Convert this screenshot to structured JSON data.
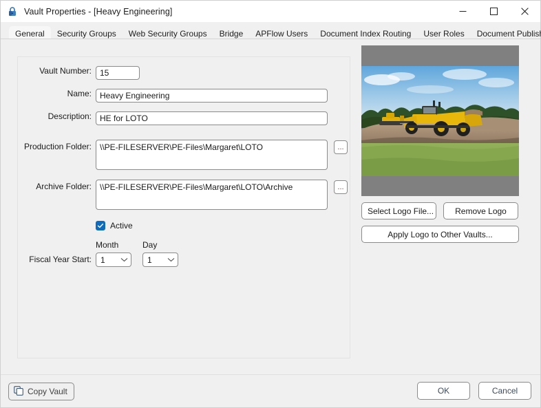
{
  "window": {
    "title": "Vault Properties - [Heavy Engineering]",
    "icon": "lock-icon",
    "minimize_label": "—",
    "maximize_label": "□",
    "close_label": "✕"
  },
  "tabs": [
    {
      "label": "General",
      "active": true
    },
    {
      "label": "Security Groups",
      "active": false
    },
    {
      "label": "Web Security Groups",
      "active": false
    },
    {
      "label": "Bridge",
      "active": false
    },
    {
      "label": "APFlow Users",
      "active": false
    },
    {
      "label": "Document Index Routing",
      "active": false
    },
    {
      "label": "User Roles",
      "active": false
    },
    {
      "label": "Document Publishing",
      "active": false
    }
  ],
  "form": {
    "vault_number": {
      "label": "Vault Number:",
      "value": "15"
    },
    "name": {
      "label": "Name:",
      "value": "Heavy Engineering"
    },
    "description": {
      "label": "Description:",
      "value": "HE for LOTO"
    },
    "production_folder": {
      "label": "Production Folder:",
      "value": "\\\\PE-FILESERVER\\PE-Files\\Margaret\\LOTO",
      "browse_label": "..."
    },
    "archive_folder": {
      "label": "Archive Folder:",
      "value": "\\\\PE-FILESERVER\\PE-Files\\Margaret\\LOTO\\Archive",
      "browse_label": "..."
    },
    "active": {
      "label": "Active",
      "checked": true
    },
    "fiscal_year_start": {
      "label": "Fiscal Year Start:",
      "month_header": "Month",
      "day_header": "Day",
      "month_value": "1",
      "day_value": "1"
    }
  },
  "logo": {
    "alt": "construction-earthmoving-equipment-photo",
    "select_label": "Select Logo File...",
    "remove_label": "Remove Logo",
    "apply_label": "Apply Logo to Other Vaults..."
  },
  "footer": {
    "copy_vault_label": "Copy Vault",
    "copy_vault_icon": "copy-icon",
    "ok_label": "OK",
    "cancel_label": "Cancel"
  },
  "colors": {
    "accent": "#0f6cbd",
    "window_bg": "#f0f0f0",
    "titlebar_bg": "#ffffff",
    "logo_frame": "#808080",
    "field_border": "#8a8a8a"
  }
}
